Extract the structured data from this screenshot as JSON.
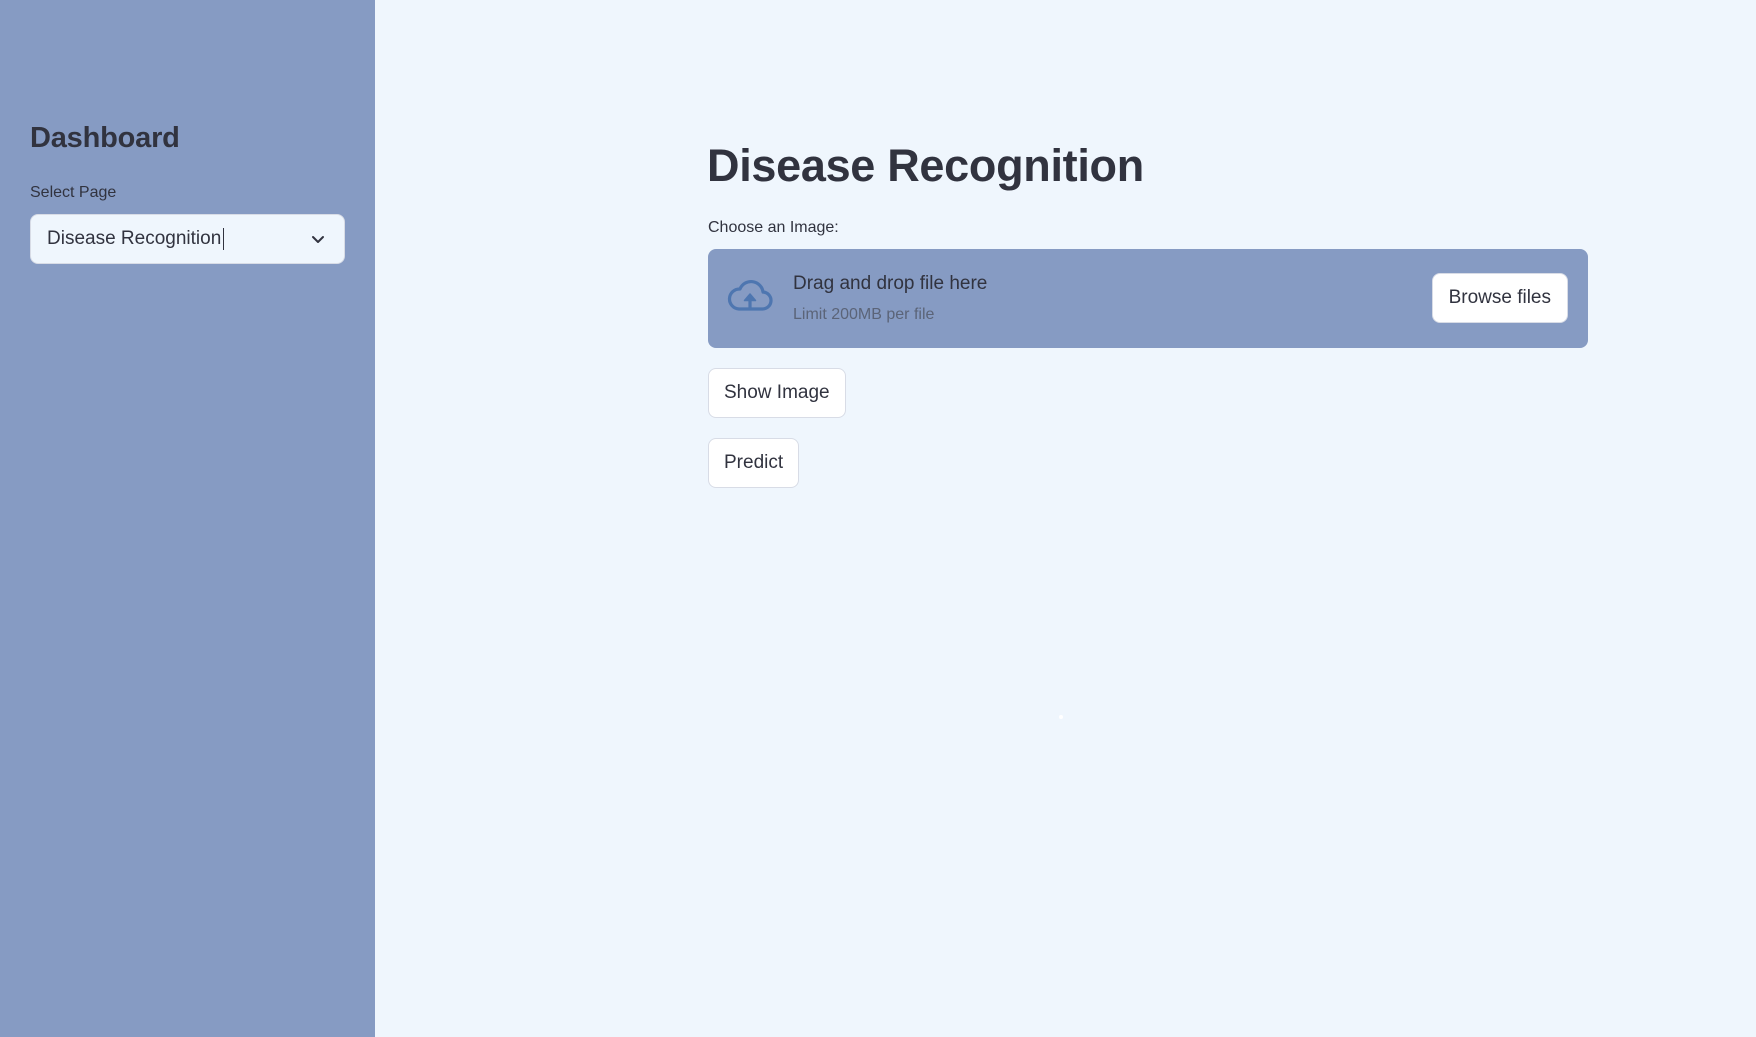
{
  "sidebar": {
    "title": "Dashboard",
    "select_label": "Select Page",
    "select_value": "Disease Recognition",
    "chevron_icon": "chevron-down-icon"
  },
  "main": {
    "title": "Disease Recognition",
    "uploader": {
      "label": "Choose an Image:",
      "drop_text": "Drag and drop file here",
      "limit_text": "Limit 200MB per file",
      "browse_label": "Browse files",
      "icon": "cloud-upload-icon"
    },
    "buttons": {
      "show_image": "Show Image",
      "predict": "Predict"
    }
  },
  "colors": {
    "sidebar_bg": "#869bc3",
    "main_bg": "#eff6fd",
    "text": "#31333f",
    "dropzone_bg": "#869bc3"
  }
}
